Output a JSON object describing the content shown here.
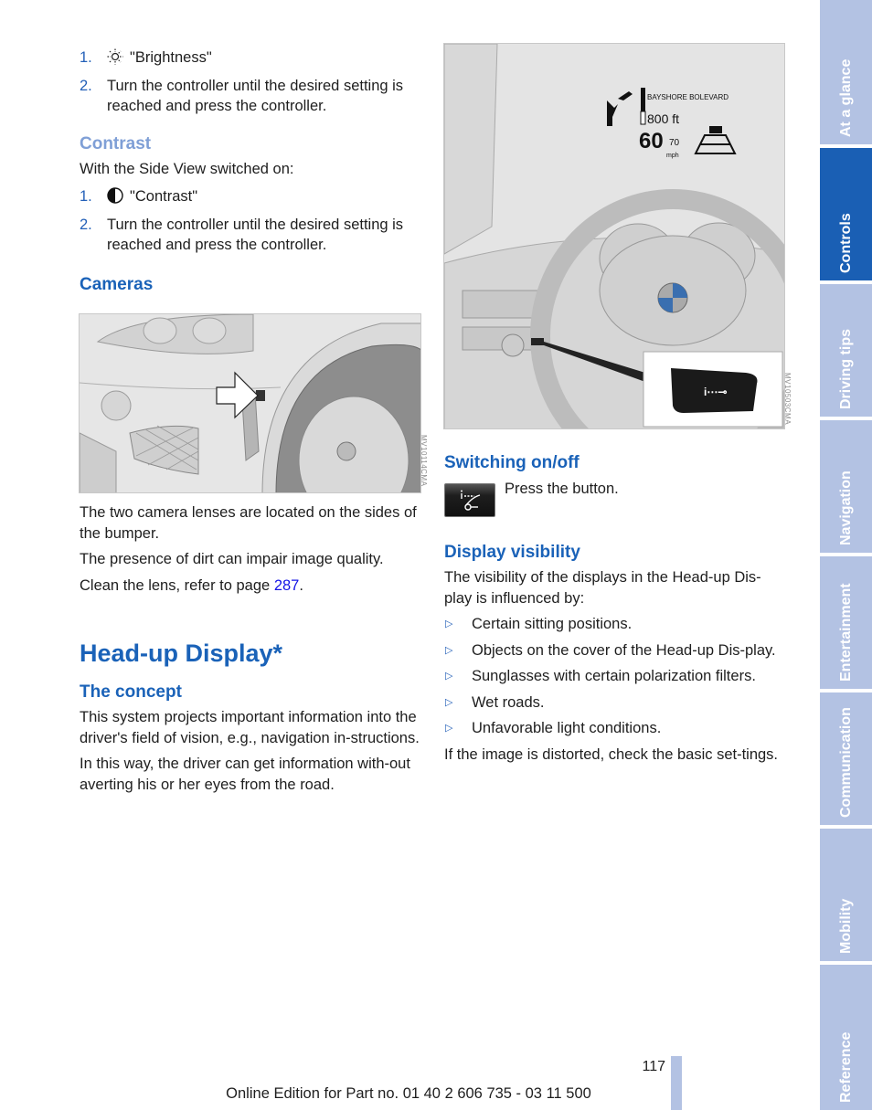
{
  "left_column": {
    "brightness_steps": [
      {
        "num": "1.",
        "icon": "sun-icon",
        "text": "\"Brightness\""
      },
      {
        "num": "2.",
        "text": "Turn the controller until the desired setting is reached and press the controller."
      }
    ],
    "contrast": {
      "heading": "Contrast",
      "intro": "With the Side View switched on:",
      "steps": [
        {
          "num": "1.",
          "icon": "half-circle-contrast-icon",
          "text": "\"Contrast\""
        },
        {
          "num": "2.",
          "text": "Turn the controller until the desired setting is reached and press the controller."
        }
      ]
    },
    "cameras": {
      "heading": "Cameras",
      "figure_code": "MV10114CMA",
      "paragraphs": [
        "The two camera lenses are located on the sides of the bumper.",
        "The presence of dirt can impair image quality."
      ],
      "clean_text_before": "Clean the lens, refer to page ",
      "clean_link": "287",
      "clean_text_after": "."
    },
    "hud": {
      "title": "Head-up Display*",
      "concept_heading": "The concept",
      "paragraphs": [
        "This system projects important information into the driver's field of vision, e.g., navigation in-structions.",
        "In this way, the driver can get information with-out averting his or her eyes from the road."
      ]
    }
  },
  "hud_figure": {
    "street": "BAYSHORE BOLEVARD",
    "distance": "800 ft",
    "speed": "60",
    "speed_limit": "70",
    "speed_unit": "mph",
    "figure_code": "MV10503CMA"
  },
  "right_column": {
    "switching": {
      "heading": "Switching on/off",
      "button_icon": "head-up-display-button-icon",
      "text": "Press the button."
    },
    "visibility": {
      "heading": "Display visibility",
      "intro": "The visibility of the displays in the Head-up Dis-play is influenced by:",
      "bullets": [
        "Certain sitting positions.",
        "Objects on the cover of the Head-up Dis-play.",
        "Sunglasses with certain polarization filters.",
        "Wet roads.",
        "Unfavorable light conditions."
      ],
      "outro": "If the image is distorted, check the basic set-tings."
    }
  },
  "sidebar": {
    "tabs": [
      {
        "label": "At a glance",
        "active": false
      },
      {
        "label": "Controls",
        "active": true
      },
      {
        "label": "Driving tips",
        "active": false
      },
      {
        "label": "Navigation",
        "active": false
      },
      {
        "label": "Entertainment",
        "active": false
      },
      {
        "label": "Communication",
        "active": false
      },
      {
        "label": "Mobility",
        "active": false
      },
      {
        "label": "Reference",
        "active": false
      }
    ]
  },
  "footer": {
    "page_number": "117",
    "edition": "Online Edition for Part no. 01 40 2 606 735 - 03 11 500"
  },
  "colors": {
    "heading_blue": "#1a62b8",
    "heading_light_blue": "#7f9fd6",
    "link_blue": "#1414e6",
    "tab_inactive": "#b3c2e3",
    "tab_active": "#1a5fb4"
  }
}
